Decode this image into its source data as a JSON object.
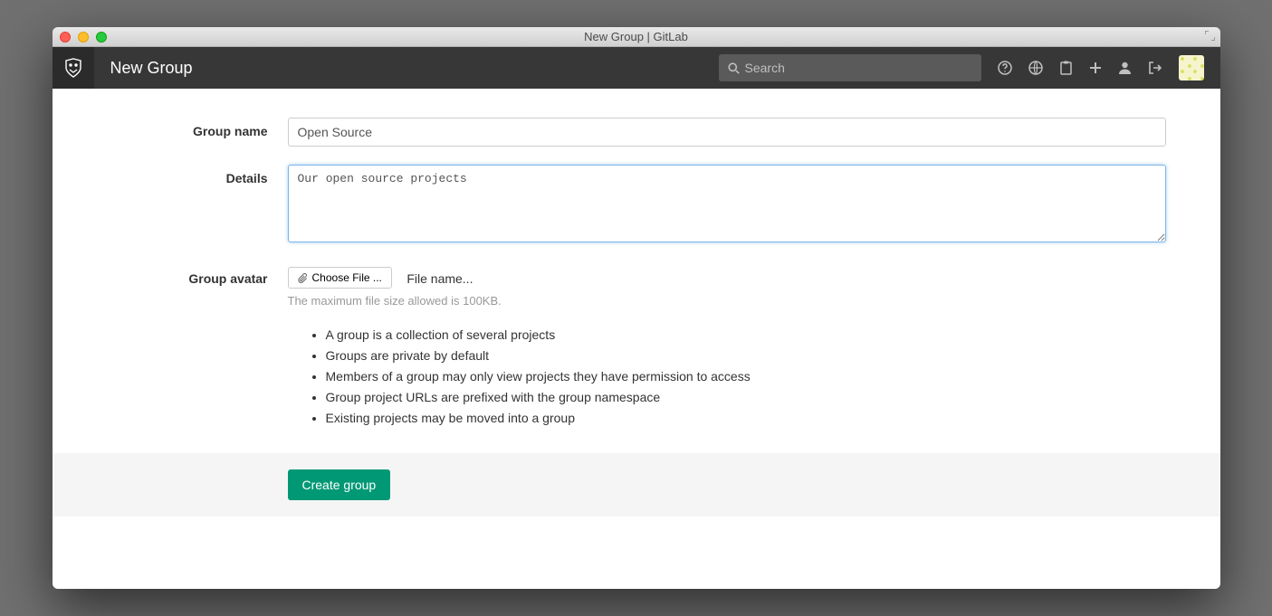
{
  "window": {
    "title": "New Group | GitLab"
  },
  "header": {
    "page_title": "New Group",
    "search_placeholder": "Search"
  },
  "form": {
    "group_name_label": "Group name",
    "group_name_value": "Open Source",
    "details_label": "Details",
    "details_value": "Our open source projects",
    "avatar_label": "Group avatar",
    "choose_file_label": "Choose File ...",
    "file_name_text": "File name...",
    "size_hint": "The maximum file size allowed is 100KB.",
    "info": [
      "A group is a collection of several projects",
      "Groups are private by default",
      "Members of a group may only view projects they have permission to access",
      "Group project URLs are prefixed with the group namespace",
      "Existing projects may be moved into a group"
    ],
    "submit_label": "Create group"
  }
}
